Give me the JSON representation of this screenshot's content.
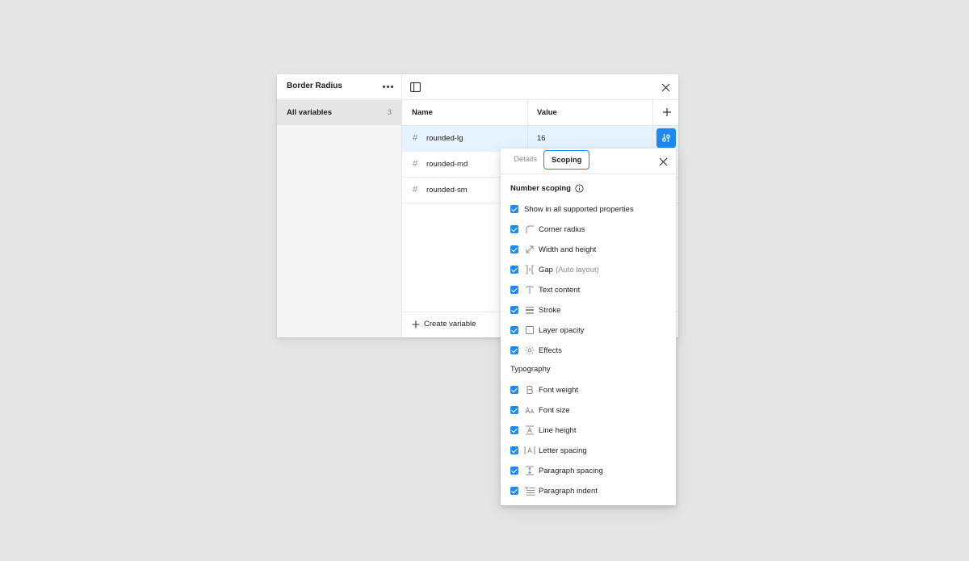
{
  "collection": {
    "title": "Border Radius",
    "more_icon": "more-horizontal-icon"
  },
  "sidebar": {
    "items": [
      {
        "label": "All variables",
        "count": "3"
      }
    ]
  },
  "table": {
    "headers": {
      "name": "Name",
      "value": "Value"
    },
    "rows": [
      {
        "name": "rounded-lg",
        "value": "16",
        "type_icon": "number-hash-icon"
      },
      {
        "name": "rounded-md",
        "value": "",
        "type_icon": "number-hash-icon"
      },
      {
        "name": "rounded-sm",
        "value": "",
        "type_icon": "number-hash-icon"
      }
    ],
    "create_label": "Create variable"
  },
  "popover": {
    "tabs": {
      "details": "Details",
      "scoping": "Scoping"
    },
    "active_tab": "Scoping",
    "number_scoping": "Number scoping",
    "show_all": "Show in all supported properties",
    "options": [
      {
        "label": "Corner radius",
        "icon": "corner-radius-icon",
        "checked": true
      },
      {
        "label": "Width and height",
        "icon": "resize-arrow-icon",
        "checked": true
      },
      {
        "label": "Gap",
        "sub": "(Auto layout)",
        "icon": "gap-icon",
        "checked": true
      },
      {
        "label": "Text content",
        "icon": "text-icon",
        "checked": true
      },
      {
        "label": "Stroke",
        "icon": "stroke-icon",
        "checked": true
      },
      {
        "label": "Layer opacity",
        "icon": "opacity-icon",
        "checked": true
      },
      {
        "label": "Effects",
        "icon": "effects-icon",
        "checked": true
      }
    ],
    "typography_label": "Typography",
    "typography_options": [
      {
        "label": "Font weight",
        "icon": "font-weight-icon",
        "checked": true
      },
      {
        "label": "Font size",
        "icon": "font-size-icon",
        "checked": true
      },
      {
        "label": "Line height",
        "icon": "line-height-icon",
        "checked": true
      },
      {
        "label": "Letter spacing",
        "icon": "letter-spacing-icon",
        "checked": true
      },
      {
        "label": "Paragraph spacing",
        "icon": "paragraph-spacing-icon",
        "checked": true
      },
      {
        "label": "Paragraph indent",
        "icon": "paragraph-indent-icon",
        "checked": true
      }
    ]
  },
  "colors": {
    "accent": "#1d89f5",
    "selected_row": "#e5f2ff",
    "background": "#e5e5e5"
  }
}
